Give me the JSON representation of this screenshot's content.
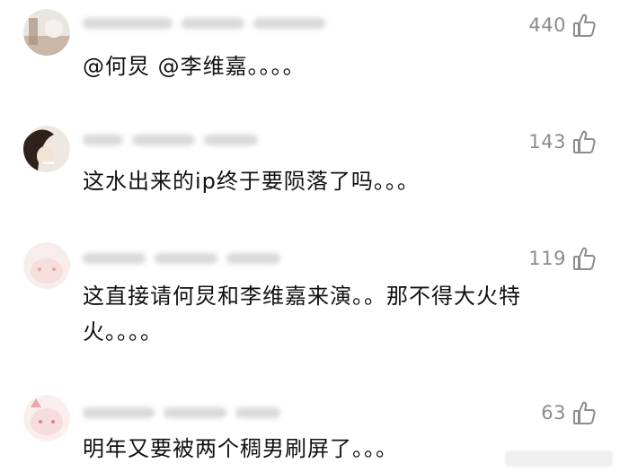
{
  "comments": [
    {
      "likes": "440",
      "lines": [
        "@何炅 @李维嘉。。。。"
      ],
      "avatar_colors": [
        "#e8e4df",
        "#b9a89a"
      ]
    },
    {
      "likes": "143",
      "lines": [
        "这水出来的ip终于要陨落了吗。。。"
      ],
      "avatar_colors": [
        "#efe7e0",
        "#3a2a22"
      ]
    },
    {
      "likes": "119",
      "lines": [
        "这直接请何炅和李维嘉来演。。那不得大火特",
        "火。。。。"
      ],
      "avatar_colors": [
        "#f7e6e6",
        "#f0cfcf"
      ]
    },
    {
      "likes": "63",
      "lines": [
        "明年又要被两个稠男刷屏了。。。"
      ],
      "avatar_colors": [
        "#fae8e8",
        "#f0b9b9"
      ]
    }
  ],
  "colors": {
    "text": "#111111",
    "likes": "#8c8c8c",
    "meta": "#b9b9b9"
  },
  "icons": {
    "like": "thumbs-up-icon"
  }
}
